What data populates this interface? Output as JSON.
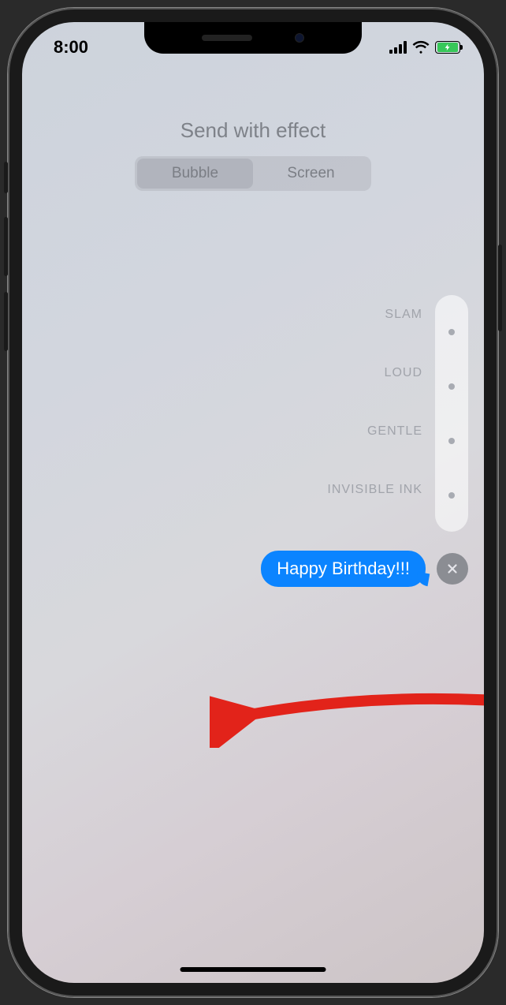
{
  "status": {
    "time": "8:00"
  },
  "title": "Send with effect",
  "segments": {
    "bubble": "Bubble",
    "screen": "Screen"
  },
  "effects": {
    "slam": "SLAM",
    "loud": "LOUD",
    "gentle": "GENTLE",
    "invisible": "INVISIBLE INK"
  },
  "message": {
    "text": "Happy Birthday!!!"
  },
  "colors": {
    "accent": "#0b84ff",
    "battery": "#37c759"
  }
}
